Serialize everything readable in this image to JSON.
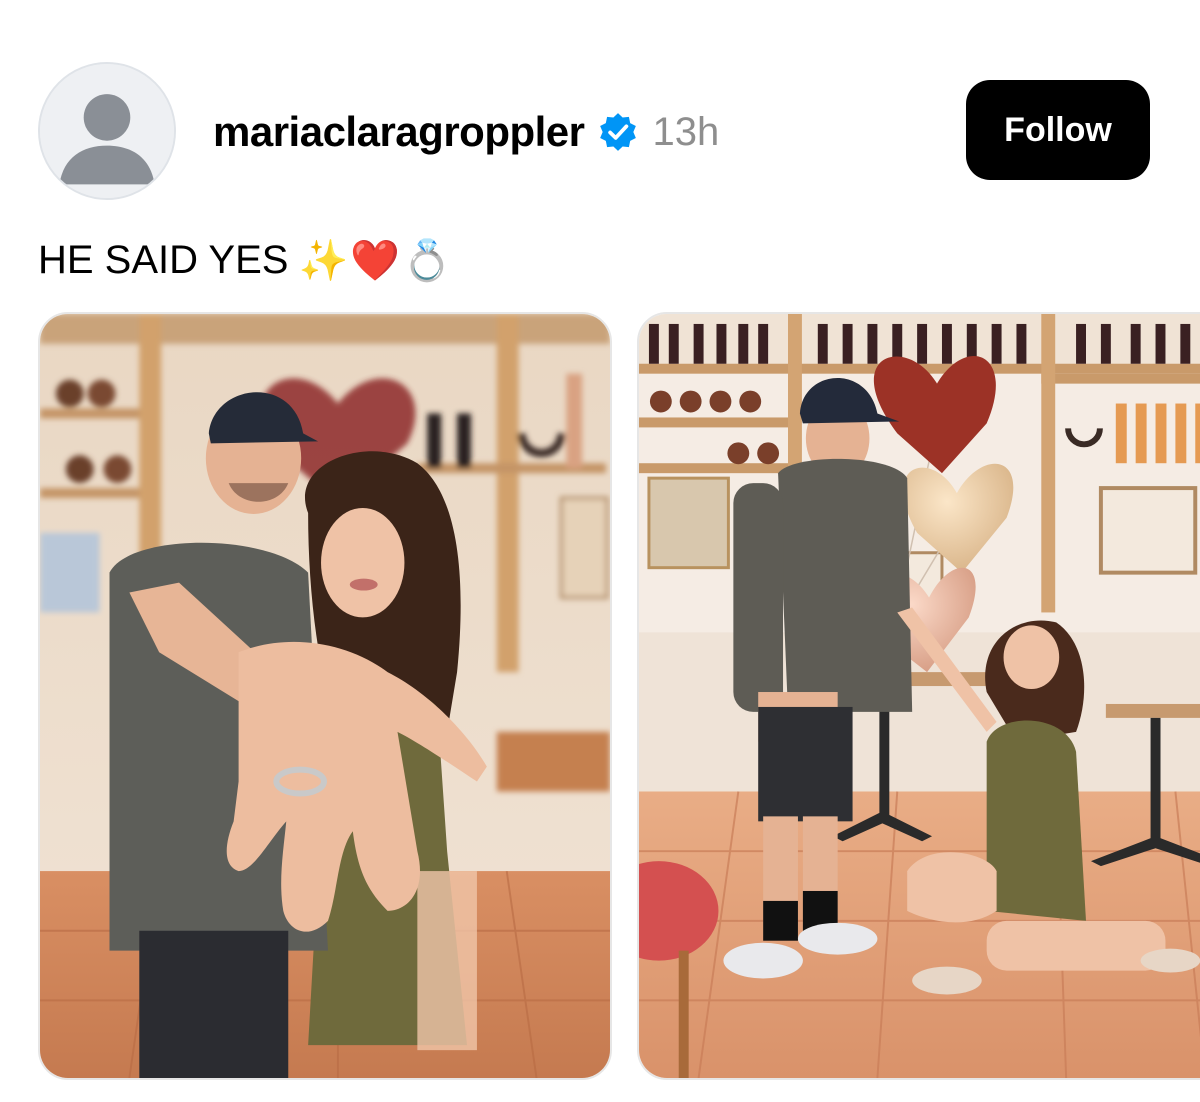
{
  "post": {
    "username": "mariaclaragroppler",
    "verified_icon": "verified-badge-icon",
    "timestamp": "13h",
    "follow_label": "Follow",
    "caption": "HE SAID YES",
    "caption_emoji": "✨❤️💍"
  },
  "media": {
    "photos": [
      {
        "name": "engagement-ring-hand-photo"
      },
      {
        "name": "proposal-kneeling-photo"
      }
    ]
  },
  "colors": {
    "follow_bg": "#000000",
    "verified_blue": "#0095f6",
    "timestamp_gray": "#8e8e8e"
  }
}
